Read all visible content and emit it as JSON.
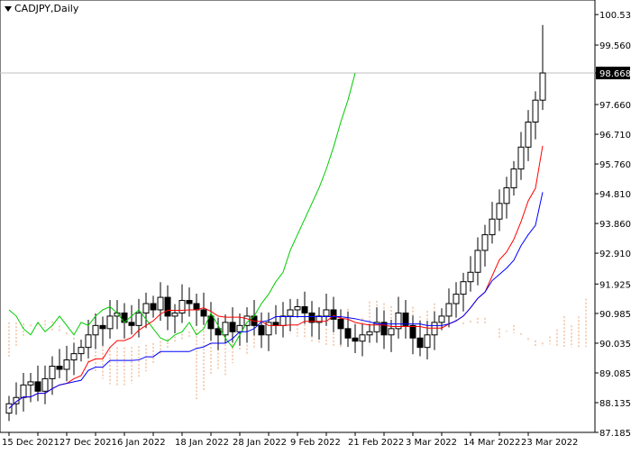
{
  "chart_data": {
    "type": "candlestick",
    "symbol_title": "CADJPY,Daily",
    "current_price": "98.668",
    "y_ticks": [
      "100.535",
      "99.560",
      "98.668",
      "97.660",
      "96.710",
      "95.760",
      "94.810",
      "93.860",
      "92.910",
      "91.925",
      "90.985",
      "90.035",
      "89.085",
      "88.135",
      "87.185"
    ],
    "y_range": [
      87.185,
      101.0
    ],
    "x_labels": [
      "15 Dec 2021",
      "27 Dec 2021",
      "6 Jan 2022",
      "18 Jan 2022",
      "28 Jan 2022",
      "9 Feb 2022",
      "21 Feb 2022",
      "3 Mar 2022",
      "14 Mar 2022",
      "23 Mar 2022"
    ],
    "x_label_index": [
      0,
      8,
      16,
      24,
      32,
      40,
      48,
      56,
      64,
      72
    ],
    "x_ticks": [
      0,
      4,
      8,
      12,
      16,
      20,
      24,
      28,
      32,
      36,
      40,
      44,
      48,
      52,
      56,
      60,
      64,
      68,
      72
    ],
    "bar_count": 75,
    "closes": [
      88.1,
      88.3,
      88.7,
      88.8,
      88.5,
      88.9,
      89.3,
      89.2,
      89.5,
      89.7,
      89.9,
      90.3,
      90.6,
      90.5,
      90.9,
      91.0,
      90.7,
      90.6,
      91.0,
      91.3,
      91.1,
      91.5,
      90.9,
      91.0,
      91.4,
      91.3,
      91.1,
      90.9,
      90.5,
      90.3,
      90.7,
      90.4,
      90.6,
      90.9,
      90.6,
      90.3,
      90.7,
      90.6,
      90.9,
      91.1,
      91.2,
      91.0,
      90.7,
      90.9,
      91.1,
      90.8,
      90.5,
      90.2,
      90.1,
      90.3,
      90.4,
      90.7,
      90.3,
      90.5,
      91.0,
      90.6,
      90.2,
      89.9,
      90.3,
      90.7,
      90.9,
      91.3,
      91.6,
      92.0,
      92.3,
      93.0,
      93.5,
      94.0,
      94.5,
      95.0,
      95.6,
      96.3,
      97.1,
      97.8,
      98.668
    ],
    "price_line": 98.668,
    "colors": {
      "bull_candle": "#ffffff",
      "bear_candle": "#000000",
      "tenkan": "#ff0000",
      "kijun": "#0000ff",
      "chikou": "#00cc00",
      "cloud": "#e8a070",
      "price_line": "#c0c0c0"
    }
  }
}
